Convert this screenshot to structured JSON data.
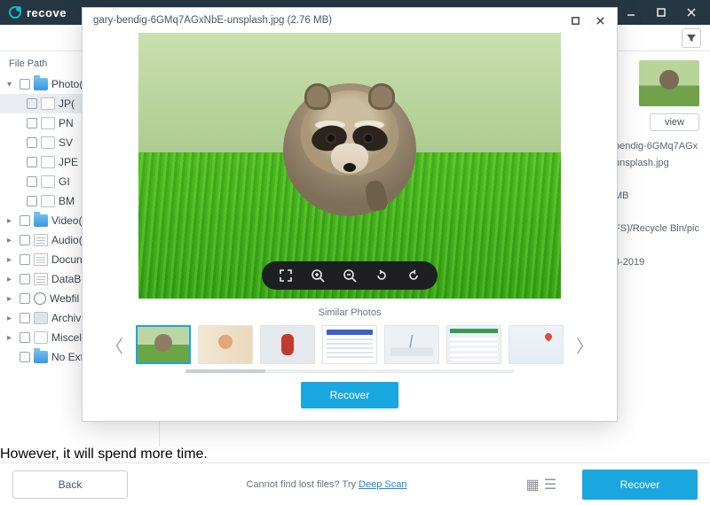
{
  "titlebar": {
    "brand": "recove"
  },
  "sidebar": {
    "heading": "File Path",
    "photo": "Photo(",
    "jpg": "JP(",
    "png": "PN",
    "svg": "SV",
    "jpeg": "JPE",
    "gif": "GI",
    "bmp": "BM",
    "video": "Video(",
    "audio": "Audio(",
    "docs": "Docun",
    "db": "DataB",
    "web": "Webfil",
    "archive": "Archiv",
    "misc": "Miscel",
    "noext": "No Ext"
  },
  "right": {
    "view": "view",
    "fn1": "bendig-6GMq7AGx",
    "fn2": "unsplash.jpg",
    "size": "MB",
    "path": "FS)/Recycle Bin/pic",
    "date": "3-2019"
  },
  "footer": {
    "back": "Back",
    "hint_prefix": "Cannot find lost files? Try ",
    "hint_link": "Deep Scan",
    "recover": "Recover",
    "tip": "However, it will spend more time."
  },
  "modal": {
    "title": "gary-bendig-6GMq7AGxNbE-unsplash.jpg (2.76  MB)",
    "similar": "Similar Photos",
    "recover": "Recover"
  }
}
